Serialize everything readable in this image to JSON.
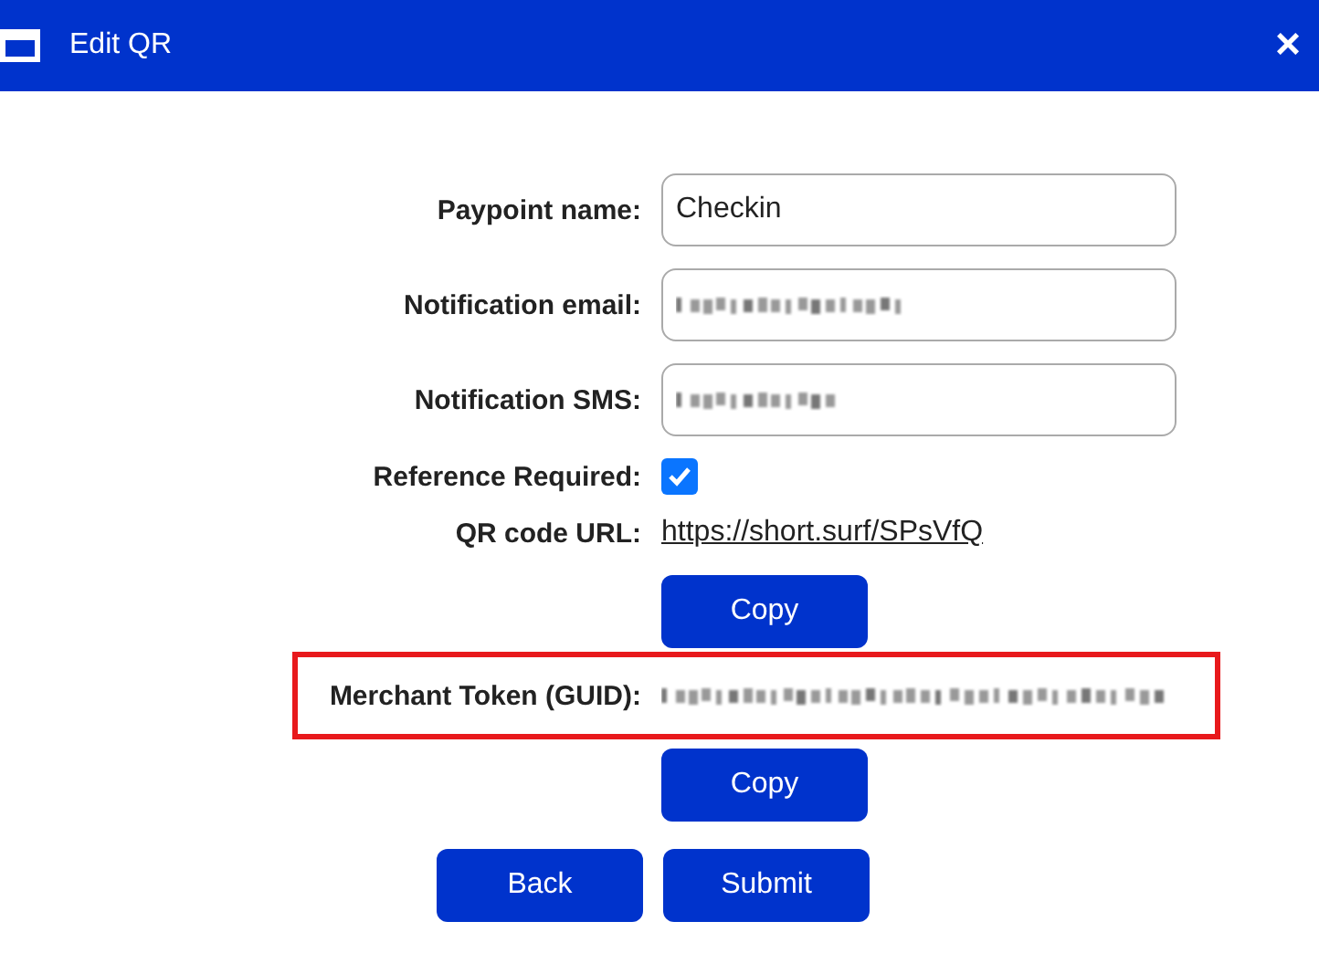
{
  "window": {
    "title": "Edit QR",
    "close": "×"
  },
  "fields": [
    {
      "kind": "text",
      "label": "Paypoint name:",
      "value": "Checkin"
    },
    {
      "kind": "redacted",
      "label": "Notification email:"
    },
    {
      "kind": "redacted",
      "label": "Notification SMS:"
    }
  ],
  "reference_required": {
    "label": "Reference Required:",
    "checked": true
  },
  "qr_url": {
    "label": "QR code URL:",
    "link": "https://short.surf/SPsVfQ",
    "button": "Copy"
  },
  "merchant_token": {
    "label": "Merchant Token (GUID):",
    "kind": "redacted",
    "highlighted": true,
    "button": "Copy"
  },
  "buttons": [
    "Back",
    "Submit"
  ]
}
